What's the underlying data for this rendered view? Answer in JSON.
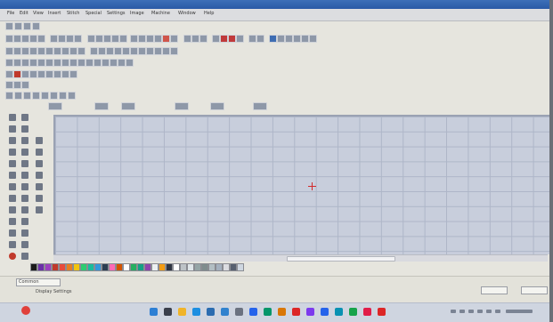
{
  "window": {
    "title": "",
    "menu": [
      "File",
      "Edit",
      "View",
      "Insert",
      "Stitch",
      "Special",
      "Settings",
      "Image",
      "Machine",
      "Window",
      "Help"
    ]
  },
  "statusbar": {
    "layer_combo": "Common",
    "display_settings": "Display Settings"
  },
  "palette": {
    "colors": [
      "#1a1a1a",
      "#6b2fa8",
      "#9b3fbf",
      "#c0392b",
      "#e74c3c",
      "#e67e22",
      "#f1c40f",
      "#2ecc71",
      "#1abc9c",
      "#3498db",
      "#2c3e50",
      "#ff69b4",
      "#d35400",
      "#ffffff",
      "#27ae60",
      "#16a085",
      "#8e44ad",
      "#ecf0f1",
      "#f39c12",
      "#2f3542",
      "#ffffff",
      "#bdc3c7",
      "#dfe6e9",
      "#95a5a6",
      "#7f8c8d",
      "#b2bec3",
      "#a4b0be",
      "#dcdde1",
      "#57606f",
      "#ced6e0"
    ]
  },
  "canvas": {
    "grid_color": "#aeb6c8",
    "background": "#c8cedc",
    "origin_marker_color": "#d22b2b"
  },
  "taskbar": {
    "icons": [
      "windows-start-icon",
      "search-icon",
      "file-explorer-icon",
      "edge-icon",
      "store-icon",
      "mail-icon",
      "settings-icon",
      "app-icon-1",
      "app-icon-2",
      "app-icon-3",
      "app-icon-4",
      "app-icon-5",
      "app-icon-6",
      "app-icon-7",
      "app-icon-8",
      "app-icon-9",
      "app-icon-10"
    ]
  }
}
